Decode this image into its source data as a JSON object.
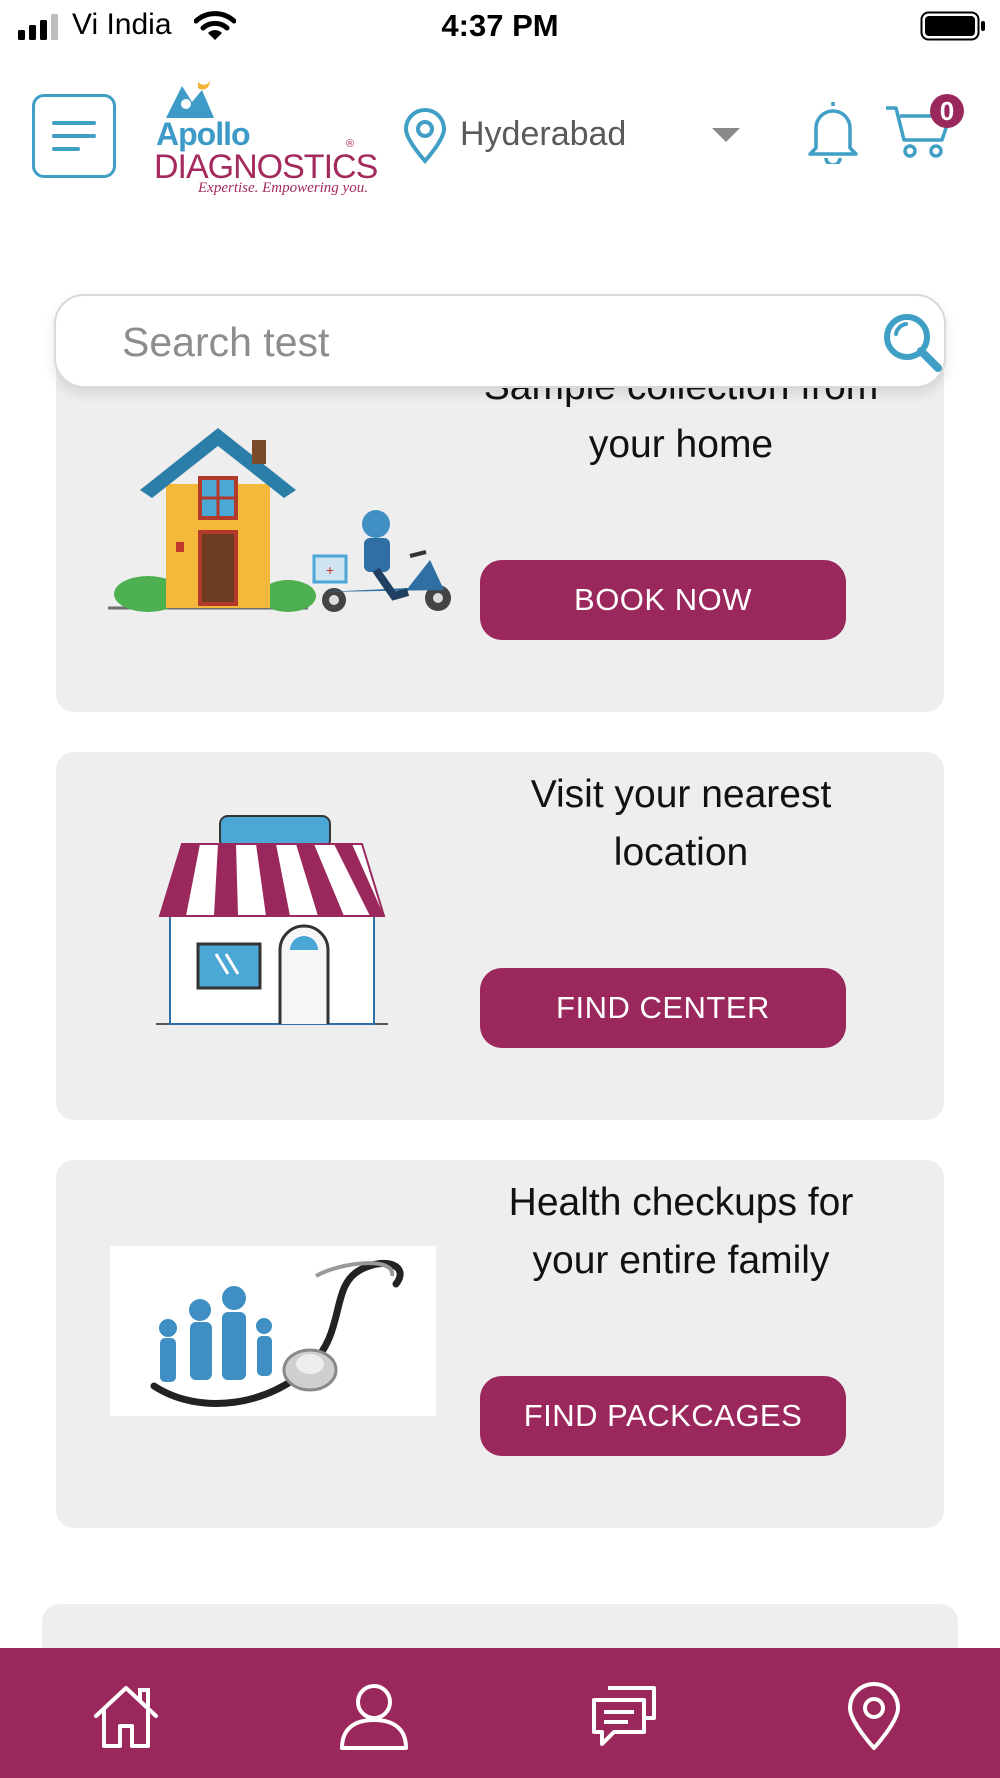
{
  "status_bar": {
    "carrier": "Vi India",
    "time": "4:37 PM"
  },
  "header": {
    "logo": {
      "brand": "Apollo",
      "name": "DIAGNOSTICS",
      "tagline": "Expertise. Empowering you.",
      "registered": "®"
    },
    "city": "Hyderabad",
    "cart_count": "0"
  },
  "search": {
    "placeholder": "Search test"
  },
  "cards": [
    {
      "title_line1": "Sample collection from",
      "title_line2": "your home",
      "button": "BOOK NOW"
    },
    {
      "title_line1": "Visit your nearest",
      "title_line2": "location",
      "button": "FIND CENTER"
    },
    {
      "title_line1": "Health checkups for",
      "title_line2": "your entire family",
      "button": "FIND PACKCAGES"
    }
  ],
  "bottom_nav": {
    "icons": [
      "home-icon",
      "profile-icon",
      "chat-icon",
      "location-icon"
    ]
  },
  "colors": {
    "brand_primary": "#9b285c",
    "brand_secondary": "#3f9fc4",
    "card_background": "#eeeeee"
  }
}
